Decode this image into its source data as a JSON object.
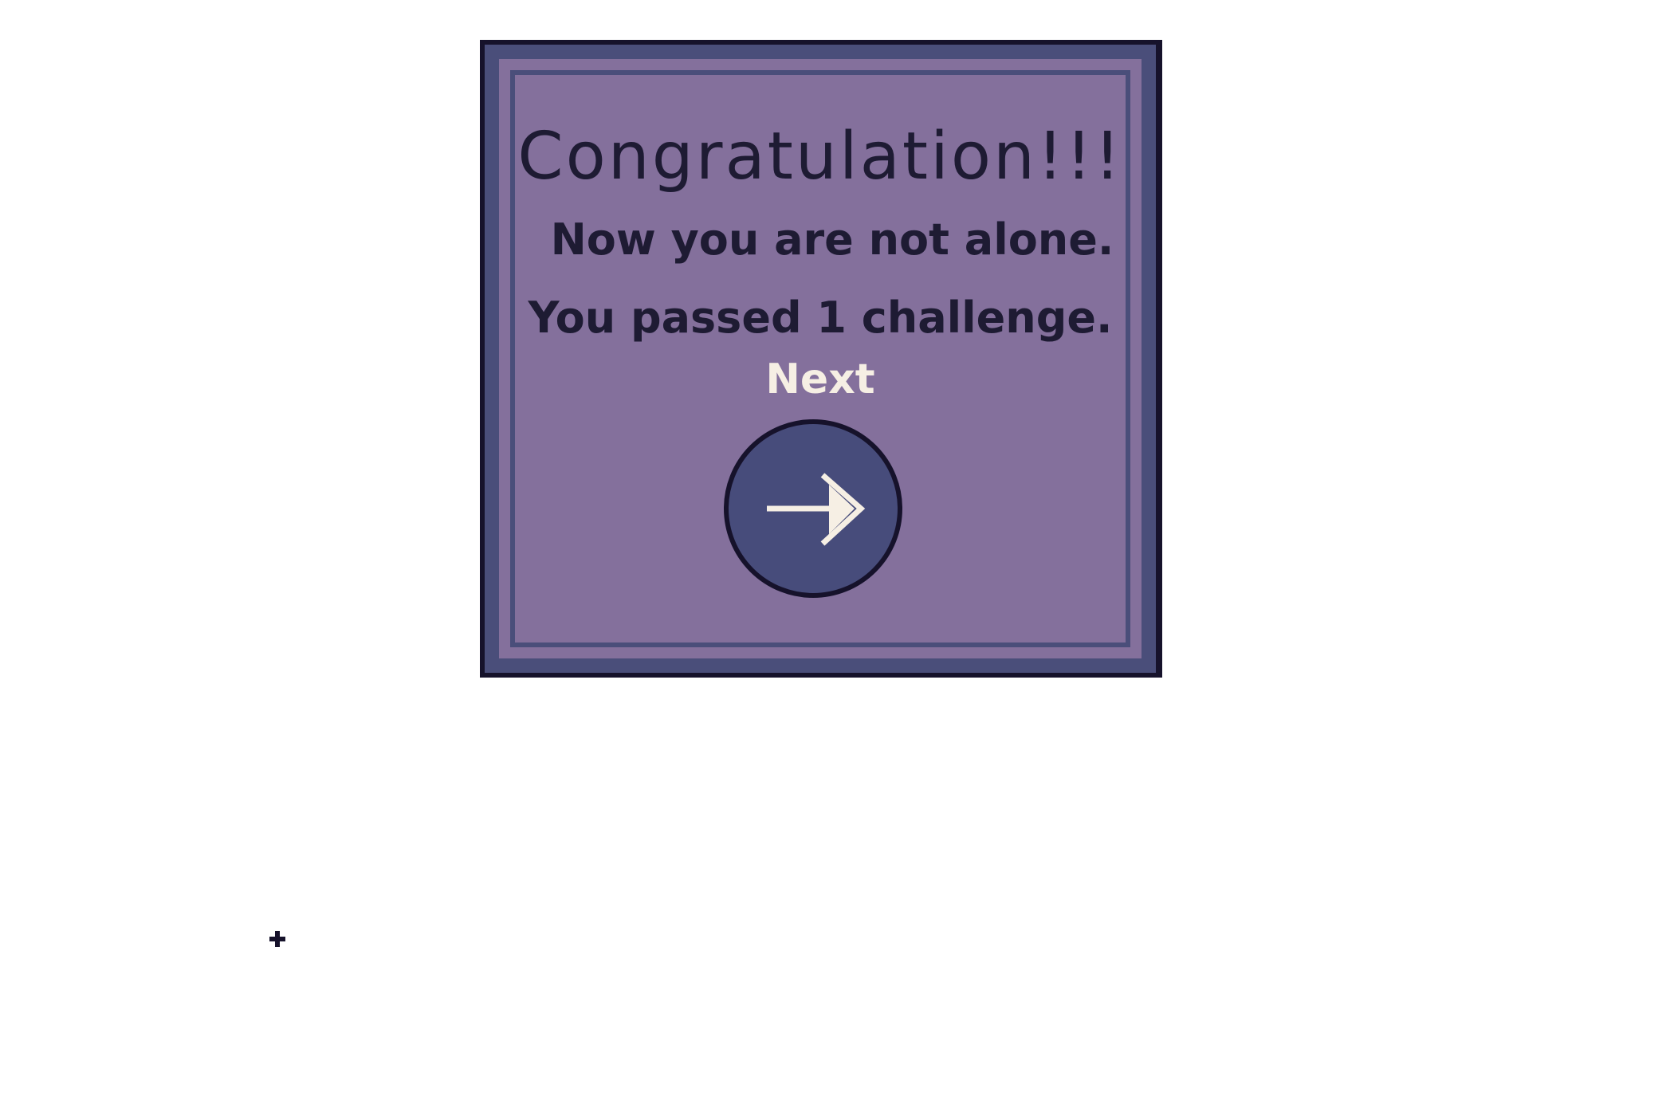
{
  "dialog": {
    "title": "Congratulation!!!",
    "message_line_1": "Now you are not alone.",
    "message_line_2": "You passed 1 challenge.",
    "next_label": "Next",
    "next_icon": "right-arrow-icon"
  },
  "colors": {
    "background": "#ffffff",
    "dialog_fill": "#84709c",
    "dialog_border": "#4a4e7a",
    "outline": "#16122b",
    "text_dark": "#1e1b33",
    "text_light": "#f6efe4",
    "button_fill": "#474c7b"
  }
}
